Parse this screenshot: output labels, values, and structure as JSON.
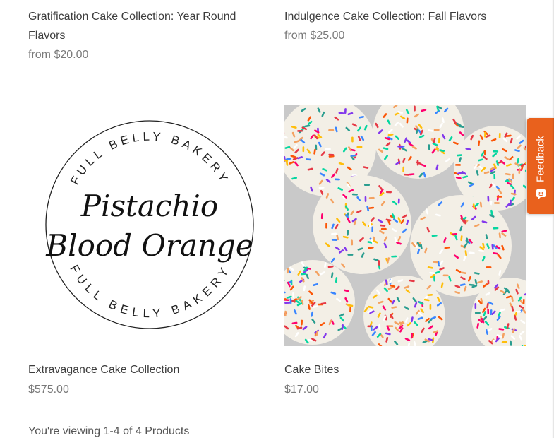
{
  "products": [
    {
      "title": "Gratification Cake Collection: Year Round Flavors",
      "price": "from $20.00"
    },
    {
      "title": "Indulgence Cake Collection: Fall Flavors",
      "price": "from $25.00"
    },
    {
      "title": "Extravagance Cake Collection",
      "price": "$575.00",
      "image": {
        "ring_top_text": "FULL BELLY BAKERY",
        "ring_bottom_text": "FULL BELLY BAKERY",
        "line1": "Pistachio",
        "line2": "Blood Orange"
      }
    },
    {
      "title": "Cake Bites",
      "price": "$17.00",
      "image_icon": "sprinkles-photo"
    }
  ],
  "pagination": {
    "summary": "You're viewing 1-4 of 4 Products"
  },
  "feedback": {
    "label": "Feedback",
    "icon": "feedback-icon",
    "color": "#e9611d"
  }
}
